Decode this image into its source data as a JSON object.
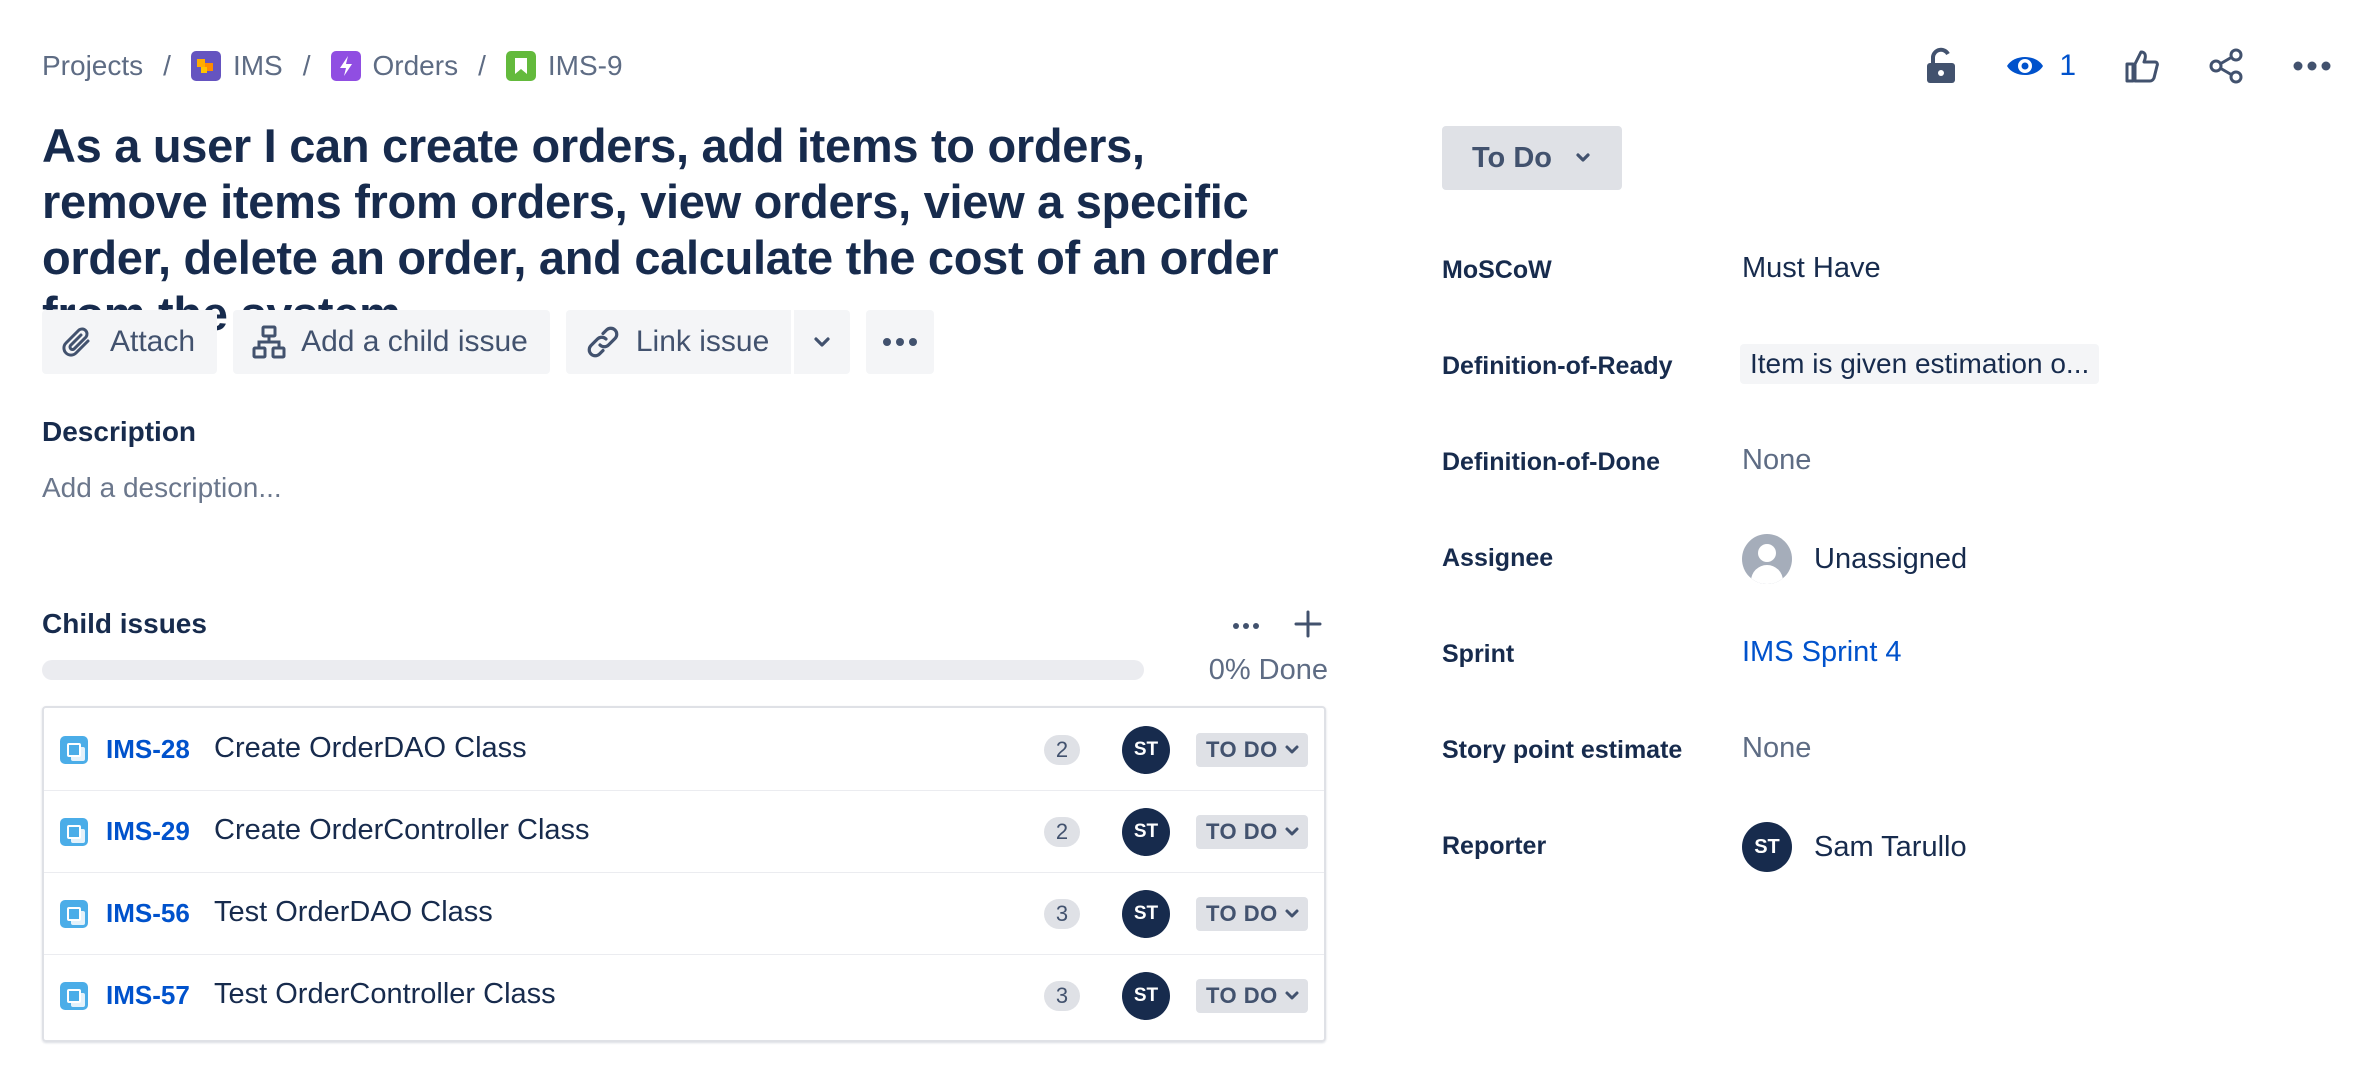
{
  "breadcrumbs": [
    {
      "label": "Projects",
      "icon": null
    },
    {
      "label": "IMS",
      "icon": "project-avatar-icon",
      "color": "#6554c0"
    },
    {
      "label": "Orders",
      "icon": "epic-icon",
      "color": "#904ee2"
    },
    {
      "label": "IMS-9",
      "icon": "story-icon",
      "color": "#63ba3c"
    }
  ],
  "top_actions": {
    "watch_count": "1",
    "icons": [
      "lock-icon",
      "eye-icon",
      "thumbs-up-icon",
      "share-icon",
      "more-icon"
    ]
  },
  "issue": {
    "title": "As a user I can create orders, add items to orders, remove items from orders, view orders, view a specific order, delete an order, and calculate the cost of an order from the system."
  },
  "actions": {
    "attach": "Attach",
    "add_child": "Add a child issue",
    "link_issue": "Link issue"
  },
  "description": {
    "label": "Description",
    "placeholder": "Add a description..."
  },
  "child_issues": {
    "title": "Child issues",
    "progress": 0,
    "progress_label": "0% Done",
    "rows": [
      {
        "key": "IMS-28",
        "summary": "Create OrderDAO Class",
        "points": "2",
        "assignee": "ST",
        "status": "TO DO"
      },
      {
        "key": "IMS-29",
        "summary": "Create OrderController Class",
        "points": "2",
        "assignee": "ST",
        "status": "TO DO"
      },
      {
        "key": "IMS-56",
        "summary": "Test OrderDAO Class",
        "points": "3",
        "assignee": "ST",
        "status": "TO DO"
      },
      {
        "key": "IMS-57",
        "summary": "Test OrderController Class",
        "points": "3",
        "assignee": "ST",
        "status": "TO DO"
      }
    ]
  },
  "sidebar": {
    "status": "To Do",
    "fields": {
      "moscow": {
        "label": "MoSCoW",
        "value": "Must Have"
      },
      "dor": {
        "label": "Definition-of-Ready",
        "value": "Item is given estimation o..."
      },
      "dod": {
        "label": "Definition-of-Done",
        "value": "None"
      },
      "assignee": {
        "label": "Assignee",
        "value": "Unassigned"
      },
      "sprint": {
        "label": "Sprint",
        "value": "IMS Sprint 4"
      },
      "story_points": {
        "label": "Story point estimate",
        "value": "None"
      },
      "reporter": {
        "label": "Reporter",
        "value": "Sam Tarullo",
        "initials": "ST"
      }
    }
  },
  "colors": {
    "link": "#0052cc",
    "text": "#172b4d",
    "subtask": "#4bade8"
  }
}
